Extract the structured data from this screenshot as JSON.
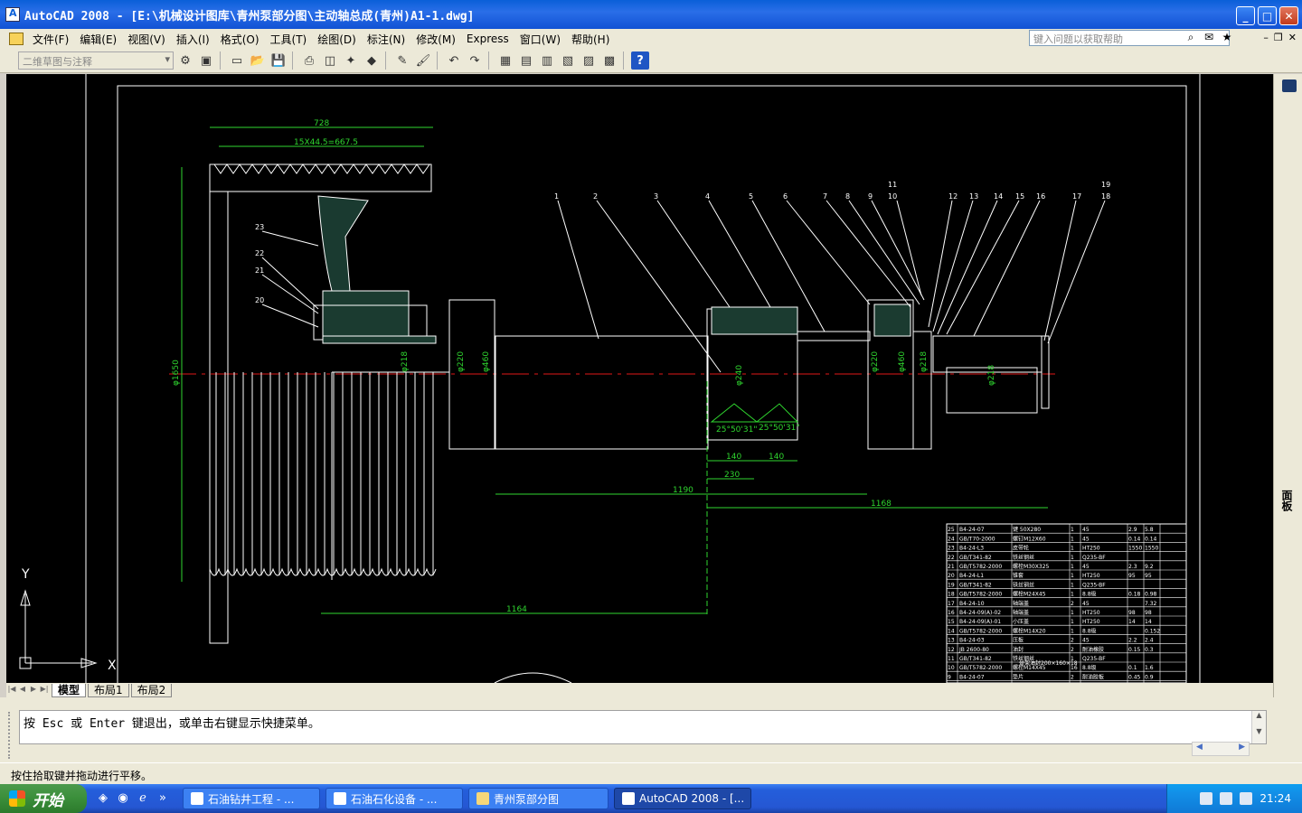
{
  "window": {
    "title": "AutoCAD 2008 - [E:\\机械设计图库\\青州泵部分图\\主动轴总成(青州)A1-1.dwg]",
    "min": "_",
    "max": "□",
    "close": "✕"
  },
  "menu": [
    "文件(F)",
    "编辑(E)",
    "视图(V)",
    "插入(I)",
    "格式(O)",
    "工具(T)",
    "绘图(D)",
    "标注(N)",
    "修改(M)",
    "Express",
    "窗口(W)",
    "帮助(H)"
  ],
  "help_search": {
    "placeholder": "键入问题以获取帮助"
  },
  "toolbar": {
    "workspace": "二维草图与注释"
  },
  "drawing": {
    "dims": {
      "d728": "728",
      "d15x": "15X44.5=667.5",
      "d1190": "1190",
      "d1168": "1168",
      "d1164": "1164",
      "d140a": "140",
      "d140b": "140",
      "d230": "230",
      "dphi1650": "φ1650",
      "angle1": "25°50'31\"",
      "angle2": "25°50'31\"",
      "dia1": "φ218",
      "dia2": "φ220",
      "dia3": "φ460",
      "dia4": "φ240",
      "dia5": "φ220",
      "dia6": "φ460",
      "dia7": "φ218",
      "dia8": "φ218"
    },
    "balloons_top": [
      "1",
      "2",
      "3",
      "4",
      "5",
      "6",
      "7",
      "8",
      "9",
      "10",
      "11",
      "12",
      "13",
      "14",
      "15",
      "16",
      "17",
      "18",
      "19"
    ],
    "balloons_left": [
      "23",
      "22",
      "21",
      "20"
    ],
    "ucs": {
      "x": "X",
      "y": "Y"
    }
  },
  "bom": [
    [
      "25",
      "B4-24-07",
      "键 50X280",
      "1",
      "45",
      "2.9",
      "5.8"
    ],
    [
      "24",
      "GB/T70-2000",
      "螺钉M12X60",
      "1",
      "45",
      "0.14",
      "0.14"
    ],
    [
      "23",
      "B4-24-L3",
      "皮带轮",
      "1",
      "HT250",
      "1550",
      "1550"
    ],
    [
      "22",
      "GB/T341-82",
      "铁丝钢丝",
      "1",
      "Q235-BF",
      "",
      ""
    ],
    [
      "21",
      "GB/T5782-2000",
      "螺栓M30X325",
      "1",
      "45",
      "2.3",
      "9.2"
    ],
    [
      "20",
      "B4-24-L1",
      "锥套",
      "1",
      "HT250",
      "95",
      "95"
    ],
    [
      "19",
      "GB/T341-82",
      "铁丝钢丝",
      "1",
      "Q235-BF",
      "",
      ""
    ],
    [
      "18",
      "GB/T5782-2000",
      "螺栓M24X45",
      "1",
      "8.8级",
      "0.18",
      "0.98"
    ],
    [
      "17",
      "B4-24-10",
      "轴端盖",
      "2",
      "45",
      "",
      "7.32"
    ],
    [
      "16",
      "B4-24-09(A)-02",
      "轴端盖",
      "1",
      "HT250",
      "98",
      "98"
    ],
    [
      "15",
      "B4-24-09(A)-01",
      "小压盖",
      "1",
      "HT250",
      "14",
      "14"
    ],
    [
      "14",
      "GB/T5782-2000",
      "螺栓M14X20",
      "1",
      "8.8级",
      "",
      "0.152"
    ],
    [
      "13",
      "B4-24-03",
      "压板",
      "2",
      "45",
      "2.2",
      "2.4"
    ],
    [
      "12",
      "JB 2600-80",
      "油封",
      "2",
      "耐油橡胶",
      "0.15",
      "0.3"
    ],
    [
      "11",
      "GB/T341-82",
      "铁丝钢丝",
      "1",
      "Q235-BF",
      "",
      ""
    ],
    [
      "10",
      "GB/T5782-2000",
      "螺栓M14X45",
      "16",
      "8.8级",
      "0.1",
      "1.6"
    ],
    [
      "9",
      "B4-24-07",
      "垫片",
      "2",
      "耐油胶板",
      "0.45",
      "0.9"
    ]
  ],
  "bom_extra": "骨架油封200×160×18",
  "tabs": [
    "模型",
    "布局1",
    "布局2"
  ],
  "command": {
    "prompt": "按 Esc 或 Enter 键退出，或单击右键显示快捷菜单。"
  },
  "status": "按住拾取键并拖动进行平移。",
  "palette_label": "面板",
  "taskbar": {
    "start": "开始",
    "tasks": [
      "石油钻井工程 - ...",
      "石油石化设备 - ...",
      "青州泵部分图",
      "AutoCAD 2008 - [..."
    ],
    "clock": "21:24"
  }
}
